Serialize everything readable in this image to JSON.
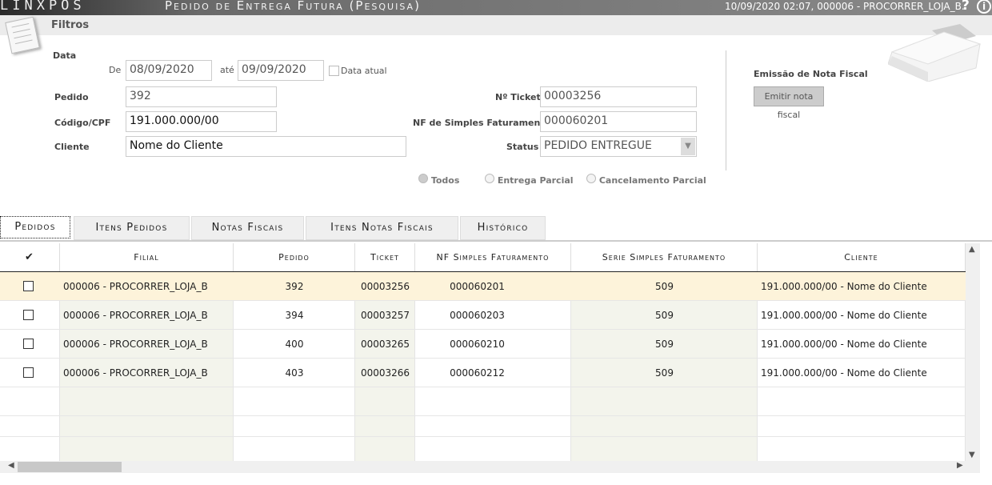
{
  "titlebar": {
    "logo": "LINXPOS",
    "title": "Pedido de Entrega Futura (Pesquisa)",
    "session": "10/09/2020 02:07, 000006 - PROCORRER_LOJA_B.",
    "help": "?",
    "info": "i"
  },
  "filters": {
    "heading": "Filtros",
    "data_label": "Data",
    "de_label": "De",
    "de_value": "08/09/2020",
    "ate_label": "até",
    "ate_value": "09/09/2020",
    "data_atual_label": "Data atual",
    "pedido_label": "Pedido",
    "pedido_value": "392",
    "codigo_label": "Código/CPF",
    "codigo_value": "191.000.000/00",
    "cliente_label": "Cliente",
    "cliente_value": "Nome  do Cliente",
    "ticket_label": "Nº Ticket",
    "ticket_value": "00003256",
    "nf_label": "NF de Simples Faturamento",
    "nf_value": "000060201",
    "status_label": "Status",
    "status_value": "PEDIDO ENTREGUE",
    "radios": [
      "Todos",
      "Entrega Parcial",
      "Cancelamento Parcial"
    ]
  },
  "nota": {
    "heading": "Emissão de Nota Fiscal",
    "button": "Emitir nota fiscal"
  },
  "tabs": [
    "Pedidos",
    "Itens Pedidos",
    "Notas Fiscais",
    "Itens Notas Fiscais",
    "Histórico"
  ],
  "grid": {
    "check_header": "✔",
    "headers": [
      "Filial",
      "Pedido",
      "Ticket",
      "NF Simples Faturamento",
      "Serie Simples Faturamento",
      "Cliente"
    ],
    "rows": [
      [
        "000006 - PROCORRER_LOJA_B",
        "392",
        "00003256",
        "000060201",
        "509",
        "191.000.000/00 - Nome  do Cliente"
      ],
      [
        "000006 - PROCORRER_LOJA_B",
        "394",
        "00003257",
        "000060203",
        "509",
        "191.000.000/00 - Nome  do Cliente"
      ],
      [
        "000006 - PROCORRER_LOJA_B",
        "400",
        "00003265",
        "000060210",
        "509",
        "191.000.000/00 - Nome  do Cliente"
      ],
      [
        "000006 - PROCORRER_LOJA_B",
        "403",
        "00003266",
        "000060212",
        "509",
        "191.000.000/00 - Nome  do Cliente"
      ]
    ]
  }
}
